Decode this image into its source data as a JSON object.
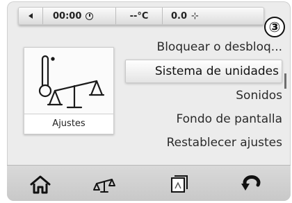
{
  "status_bar": {
    "time": "00:00",
    "temperature": "--°C",
    "fan": "0.0"
  },
  "step_badge": "③",
  "settings_tile": {
    "label": "Ajustes",
    "icon": "thermometer-balance-icon"
  },
  "menu": {
    "items": [
      {
        "label": "Bloquear o desbloq..."
      },
      {
        "label": "Sistema de unidades",
        "selected": true
      },
      {
        "label": "Sonidos"
      },
      {
        "label": "Fondo de pantalla"
      },
      {
        "label": "Restablecer ajustes"
      }
    ]
  },
  "bottom_bar": {
    "icons": [
      "home-icon",
      "balance-icon",
      "wallpaper-icon",
      "return-icon"
    ]
  }
}
